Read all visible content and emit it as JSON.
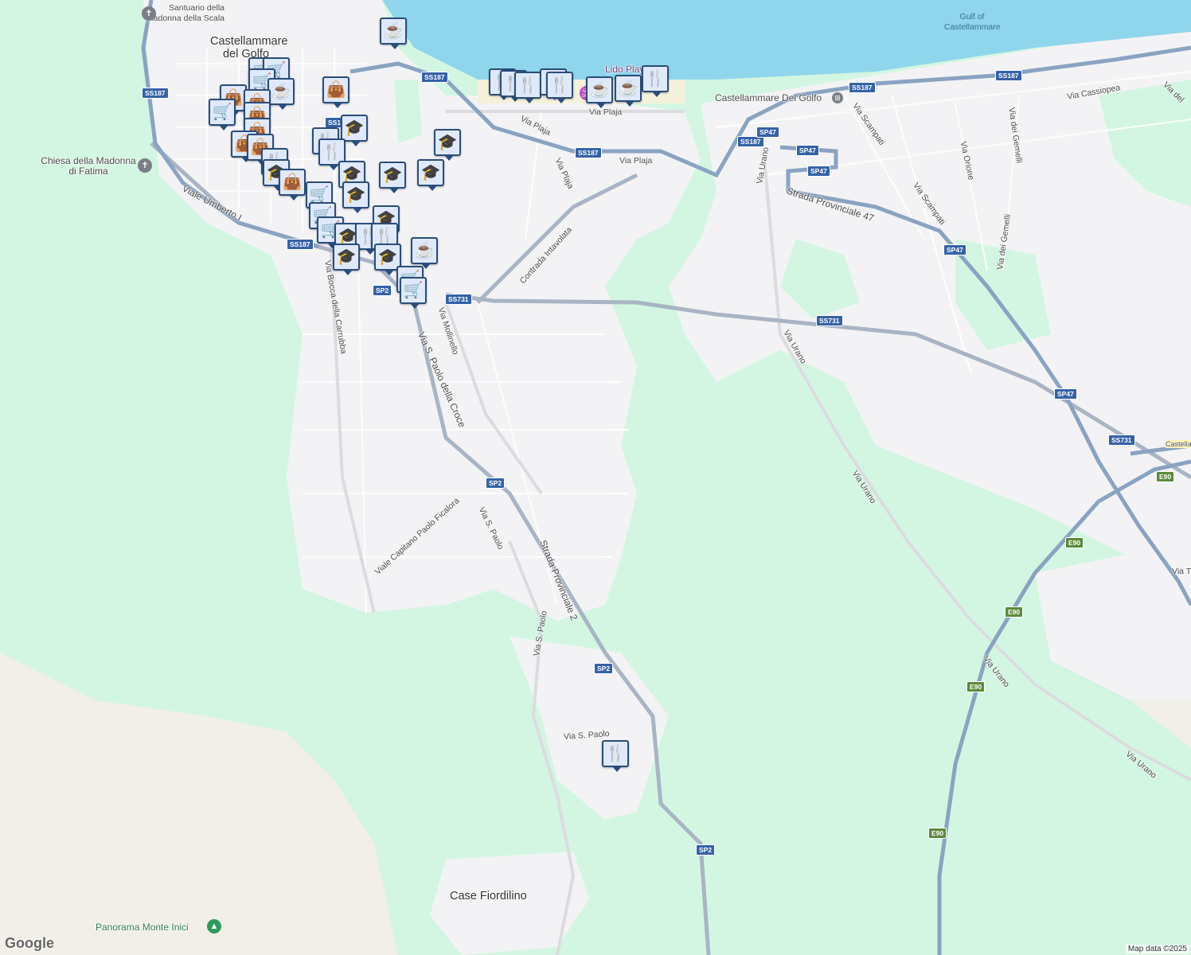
{
  "places": {
    "sanctuary": "Santuario della Madonna della Scala",
    "town": "Castellammare del Golfo",
    "church": "Chiesa della Madonna di Fatima",
    "gulf": "Gulf of Castellammare",
    "station": "Castellammare Del Golfo",
    "lido": "Lido Playa",
    "case": "Case Fiordilino",
    "panorama": "Panorama Monte Inici",
    "castellammare_edge": "Castella del G"
  },
  "streets": {
    "viale_umberto": "Viale Umberto I",
    "via_bocca": "Via Bocca della Carrubba",
    "via_spaolo_croce": "Via S. Paolo della Croce",
    "via_mollinello": "Via Mollinello",
    "contrada": "Contrada Intavolata",
    "via_plaja1": "Via Plaja",
    "via_plaja2": "Via Plaja",
    "via_plaja3": "Via Plaja",
    "via_plaja4": "Via Plaja",
    "via_urano1": "Via Urano",
    "via_urano2": "Via Urano",
    "via_urano3": "Via Urano",
    "via_urano4": "Via Urano",
    "via_urano5": "Via Urano",
    "sp47_name": "Strada Provinciale 47",
    "sp2_name": "Strada Provinciale 2",
    "via_scampati1": "Via Scampati",
    "via_scampati2": "Via Scampati",
    "via_orione": "Via Orione",
    "via_gemelli1": "Via dei Gemelli",
    "via_gemelli2": "Via dei Gemelli",
    "via_cassiopea": "Via Cassiopea",
    "via_del": "Via del",
    "via_capitano": "Viale Capitano Paolo Ficalora",
    "via_spaolo1": "Via S. Paolo",
    "via_spaolo2": "Via S. Paolo",
    "via_spaolo3": "Via S. Paolo",
    "via_t": "Via T"
  },
  "shields": {
    "ss187": "SS187",
    "sp47": "SP47",
    "sp2": "SP2",
    "ss731": "SS731",
    "e90": "E90",
    "ss1": "SS1"
  },
  "icons": {
    "restaurant": "restaurant-icon",
    "cafe": "cafe-icon",
    "shopping_cart": "shopping-cart-icon",
    "shopping_bag": "shopping-bag-icon",
    "school": "school-icon"
  },
  "colors": {
    "water": "#8fd6ec",
    "park": "#d3f6e2",
    "land": "#f3f3f5",
    "highway": "#8aa3c2",
    "mountain": "#f1efe7"
  },
  "attribution": "Map data ©2025",
  "logo": "Google"
}
